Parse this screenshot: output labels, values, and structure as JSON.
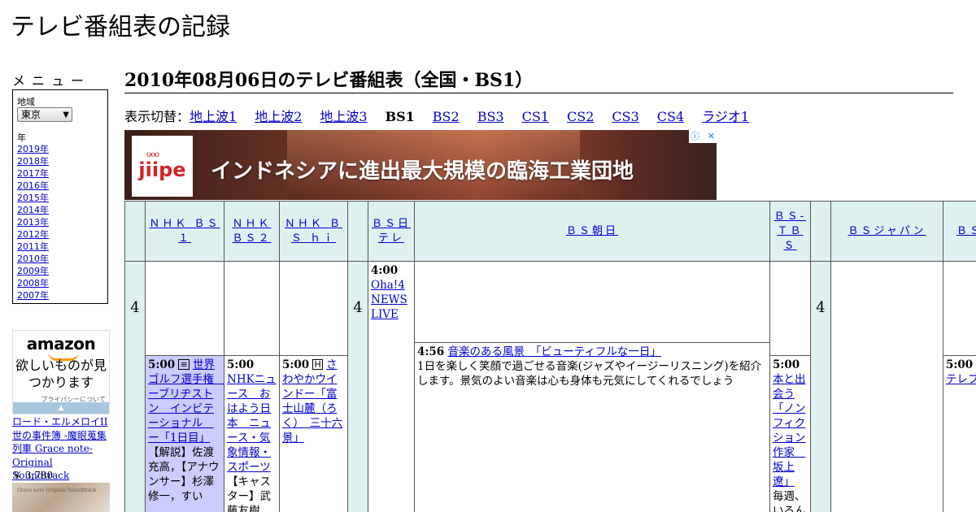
{
  "site": {
    "title": "テレビ番組表の記録"
  },
  "sidebar": {
    "menu_heading": "メニュー",
    "region_label": "地域",
    "region_value": "東京",
    "year_label": "年",
    "years": [
      "2019年",
      "2018年",
      "2017年",
      "2016年",
      "2015年",
      "2014年",
      "2013年",
      "2012年",
      "2011年",
      "2010年",
      "2009年",
      "2008年",
      "2007年"
    ]
  },
  "amazon": {
    "logo": "amazon",
    "tagline": "欲しいものが見つかります",
    "privacy": "プライバシーについて",
    "product_title": "ロード・エルメロイII世の事件簿 -魔眼蒐集列車 Grace note- Original Soundtrack",
    "price": "￥ 3,780"
  },
  "main": {
    "heading": "2010年08月06日のテレビ番組表（全国・BS1）",
    "switch_label": "表示切替：",
    "switch_items": [
      {
        "label": "地上波1",
        "current": false
      },
      {
        "label": "地上波2",
        "current": false
      },
      {
        "label": "地上波3",
        "current": false
      },
      {
        "label": "BS1",
        "current": true
      },
      {
        "label": "BS2",
        "current": false
      },
      {
        "label": "BS3",
        "current": false
      },
      {
        "label": "CS1",
        "current": false
      },
      {
        "label": "CS2",
        "current": false
      },
      {
        "label": "CS3",
        "current": false
      },
      {
        "label": "CS4",
        "current": false
      },
      {
        "label": "ラジオ1",
        "current": false
      }
    ]
  },
  "banner": {
    "logo": "jiipe",
    "text": "インドネシアに進出最大規模の臨海工業団地",
    "info_icon": "ⓘ",
    "close_icon": "✕"
  },
  "schedule": {
    "channels": [
      "ＮＨＫ ＢＳ１",
      "ＮＨＫ ＢＳ２",
      "ＮＨＫ ＢＳ ｈｉ",
      "ＢＳ日テレ",
      "ＢＳ朝日",
      "ＢＳ-ＴＢＳ",
      "ＢＳジャパン",
      "ＢＳ"
    ],
    "hour": "4",
    "programs": {
      "bsntv_1": {
        "time": "4:00",
        "title": "Oha!4 NEWS LIVE"
      },
      "bsasahi_1": {
        "time": "4:56",
        "title": "音楽のある風景　「ビューティフルな一日」",
        "desc": "1日を楽しく笑顔で過ごせる音楽(ジャズやイージーリスニング)を紹介します。景気のよい音楽は心も身体も元気にしてくれるでしょう"
      },
      "bs1_1": {
        "time": "5:00",
        "title": "世界ゴルフ選手権　ーブリヂストン　インビテーショナル　ー「1日目」",
        "desc": "【解説】佐渡充高，【アナウンサー】杉澤修一，すい"
      },
      "bs2_1": {
        "time": "5:00",
        "title": "NHKニュース　おはよう日本　ニュース・気象情報・スポーツ",
        "desc": "【キャスター】武藤友樹"
      },
      "bshi_1": {
        "time": "5:00",
        "title": "さわやかウインドー「富士山麓（ろく）　三十六景」"
      },
      "bstbs_1": {
        "time": "5:00",
        "title": "本と出会う「ノンフィクション作家　坂上遼」",
        "desc": "毎週、いろんなジャ"
      },
      "bsx_1": {
        "time": "5:00",
        "title": "鍋品テレブ"
      }
    },
    "news_color": "#ccccff",
    "header_color": "#dff0f0"
  }
}
